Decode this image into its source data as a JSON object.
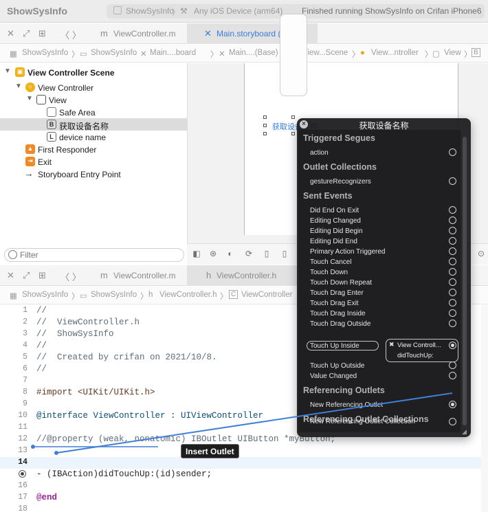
{
  "titlebar": {
    "app_name": "ShowSysInfo",
    "scheme": "ShowSysInfo",
    "destination": "Any iOS Device (arm64)",
    "status": "Finished running ShowSysInfo on Crifan iPhone6"
  },
  "top_editor": {
    "tabs": [
      {
        "label": "ViewController.m",
        "icon": "m"
      },
      {
        "label": "Main.storyboard (Base)",
        "icon": "storyboard-icon",
        "active": true
      }
    ],
    "breadcrumb": [
      "ShowSysInfo",
      "ShowSysInfo",
      "Main....board",
      "Main....(Base)",
      "View...Scene",
      "View...ntroller",
      "View",
      "B"
    ]
  },
  "outline": {
    "items": [
      {
        "label": "View Controller Scene",
        "bold": true
      },
      {
        "label": "View Controller"
      },
      {
        "label": "View"
      },
      {
        "label": "Safe Area"
      },
      {
        "label": "获取设备名称",
        "icon_letter": "B"
      },
      {
        "label": "device name",
        "icon_letter": "L"
      },
      {
        "label": "First Responder"
      },
      {
        "label": "Exit"
      },
      {
        "label": "Storyboard Entry Point"
      }
    ],
    "filter_placeholder": "Filter"
  },
  "canvas": {
    "button_label": "获取设备名称"
  },
  "bottom_editor": {
    "tabs": [
      {
        "label": "ViewController.m",
        "icon": "m"
      },
      {
        "label": "ViewController.h",
        "icon": "h"
      }
    ],
    "breadcrumb": [
      "ShowSysInfo",
      "ShowSysInfo",
      "ViewController.h",
      "ViewController"
    ]
  },
  "code": {
    "lines": [
      {
        "n": "1",
        "text": "//"
      },
      {
        "n": "2",
        "text": "//  ViewController.h"
      },
      {
        "n": "3",
        "text": "//  ShowSysInfo"
      },
      {
        "n": "4",
        "text": "//"
      },
      {
        "n": "5",
        "text": "//  Created by crifan on 2021/10/8."
      },
      {
        "n": "6",
        "text": "//"
      },
      {
        "n": "7",
        "text": ""
      },
      {
        "n": "8",
        "text": "#import <UIKit/UIKit.h>"
      },
      {
        "n": "9",
        "text": ""
      },
      {
        "n": "10",
        "text": "@interface ViewController : UIViewController"
      },
      {
        "n": "11",
        "text": ""
      },
      {
        "n": "12",
        "text": "//@property (weak, nonatomic) IBOutlet UIButton *myButton;"
      },
      {
        "n": "13",
        "text": ""
      },
      {
        "n": "14",
        "text": ""
      },
      {
        "n": "15",
        "text": "- (IBAction)didTouchUp:(id)sender;"
      },
      {
        "n": "16",
        "text": ""
      },
      {
        "n": "17",
        "text": "@end"
      }
    ],
    "current_line": "14"
  },
  "hud": {
    "title": "获取设备名称",
    "sections": {
      "triggered_segues": "Triggered Segues",
      "outlet_collections": "Outlet Collections",
      "sent_events": "Sent Events",
      "referencing_outlets": "Referencing Outlets",
      "referencing_outlet_collections": "Referencing Outlet Collections"
    },
    "triggered_segues": [
      "action"
    ],
    "outlet_collections": [
      "gestureRecognizers"
    ],
    "sent_events": [
      "Did End On Exit",
      "Editing Changed",
      "Editing Did Begin",
      "Editing Did End",
      "Primary Action Triggered",
      "Touch Cancel",
      "Touch Down",
      "Touch Down Repeat",
      "Touch Drag Enter",
      "Touch Drag Exit",
      "Touch Drag Inside",
      "Touch Drag Outside",
      "Touch Up Inside",
      "Touch Up Outside",
      "Value Changed"
    ],
    "connection_target": "View Controll...",
    "connection_action": "didTouchUp:",
    "referencing_outlets": [
      "New Referencing Outlet"
    ],
    "referencing_outlet_collections": [
      "New Referencing Outlet Collection"
    ]
  },
  "tooltip": {
    "label": "Insert Outlet"
  },
  "colors": {
    "accent": "#3a7be0",
    "hud_bg": "#1f1f21",
    "drag_line": "#3f7fd6"
  }
}
